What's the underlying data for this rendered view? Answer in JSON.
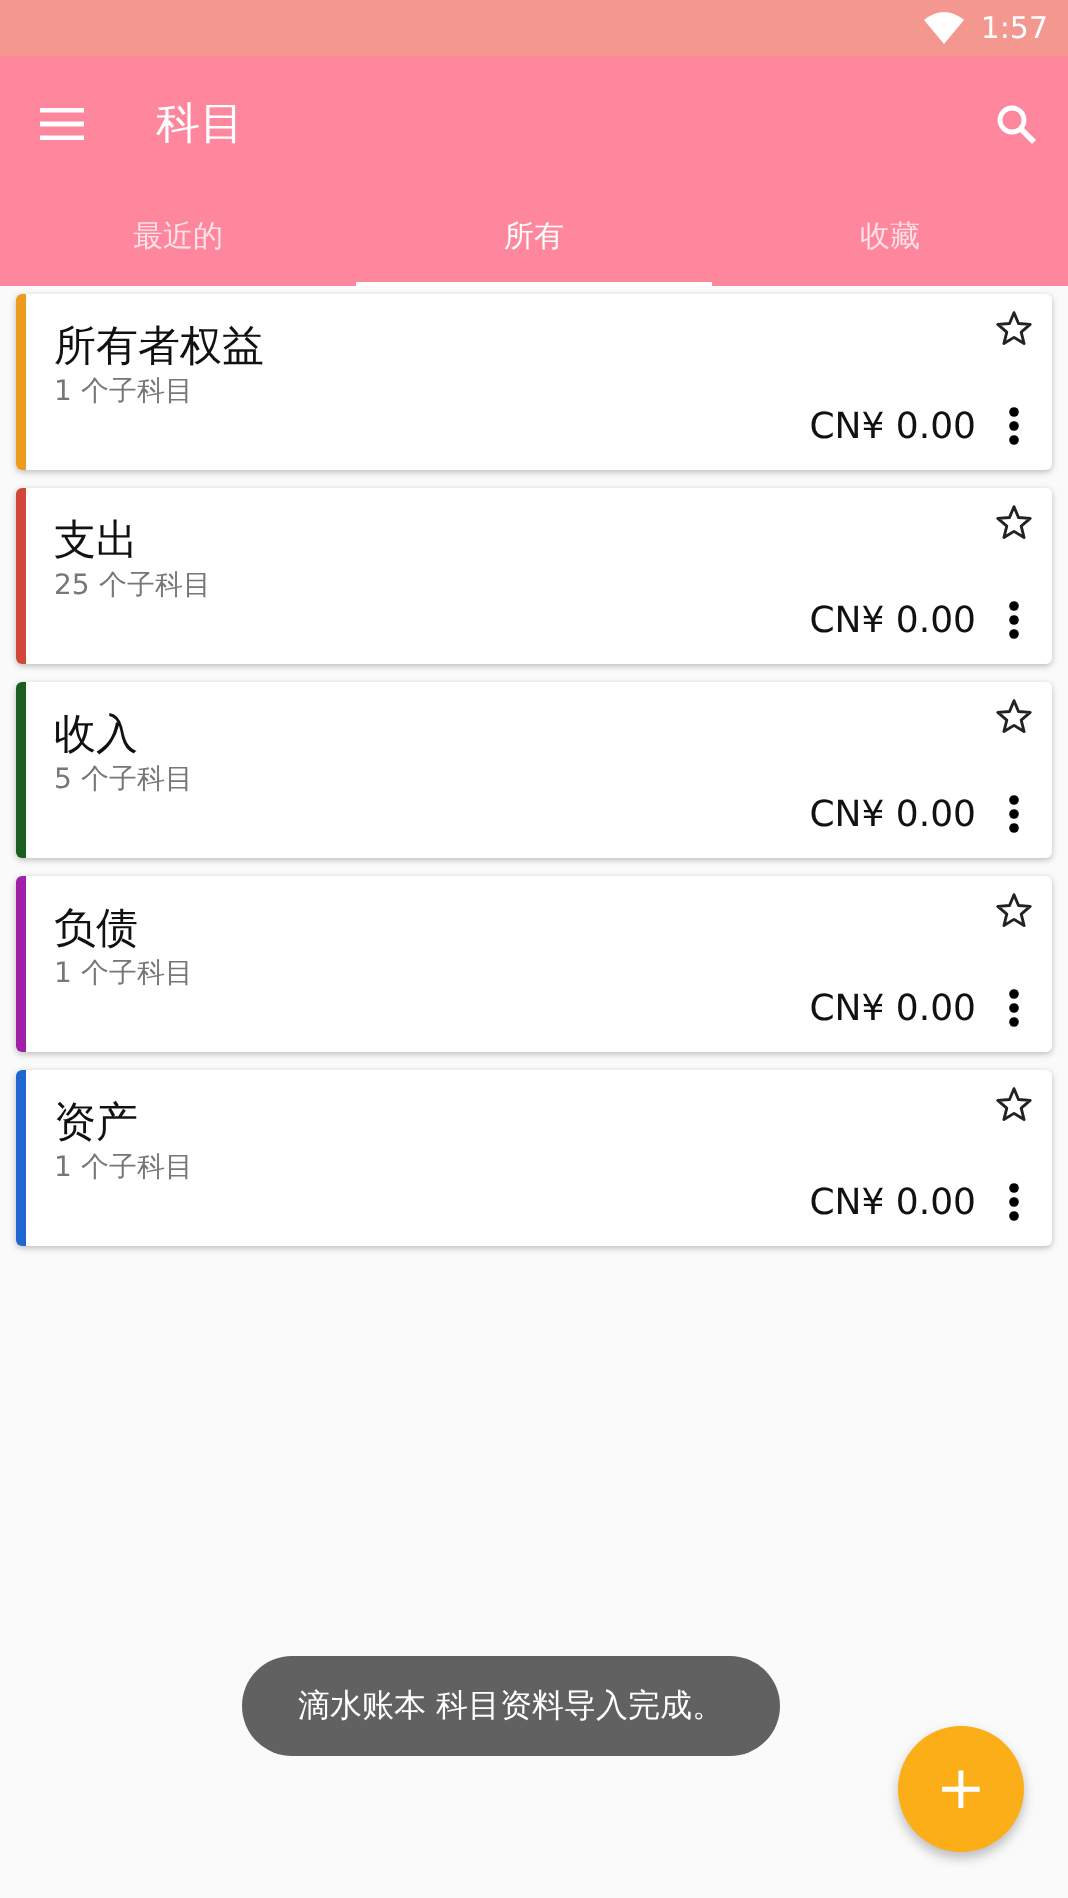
{
  "status_bar": {
    "time": "1:57"
  },
  "toolbar": {
    "title": "科目"
  },
  "tabs": [
    {
      "label": "最近的",
      "selected": false
    },
    {
      "label": "所有",
      "selected": true
    },
    {
      "label": "收藏",
      "selected": false
    }
  ],
  "accounts": [
    {
      "name": "所有者权益",
      "subaccounts": "1 个子科目",
      "balance": "CN¥ 0.00",
      "color": "#ec9b1e",
      "favorite": false
    },
    {
      "name": "支出",
      "subaccounts": "25 个子科目",
      "balance": "CN¥ 0.00",
      "color": "#d2463a",
      "favorite": false
    },
    {
      "name": "收入",
      "subaccounts": "5 个子科目",
      "balance": "CN¥ 0.00",
      "color": "#1b5e20",
      "favorite": false
    },
    {
      "name": "负债",
      "subaccounts": "1 个子科目",
      "balance": "CN¥ 0.00",
      "color": "#a020a8",
      "favorite": false
    },
    {
      "name": "资产",
      "subaccounts": "1 个子科目",
      "balance": "CN¥ 0.00",
      "color": "#1f66d1",
      "favorite": false
    }
  ],
  "toast": "滴水账本 科目资料导入完成。",
  "fab": {
    "label": "+"
  }
}
